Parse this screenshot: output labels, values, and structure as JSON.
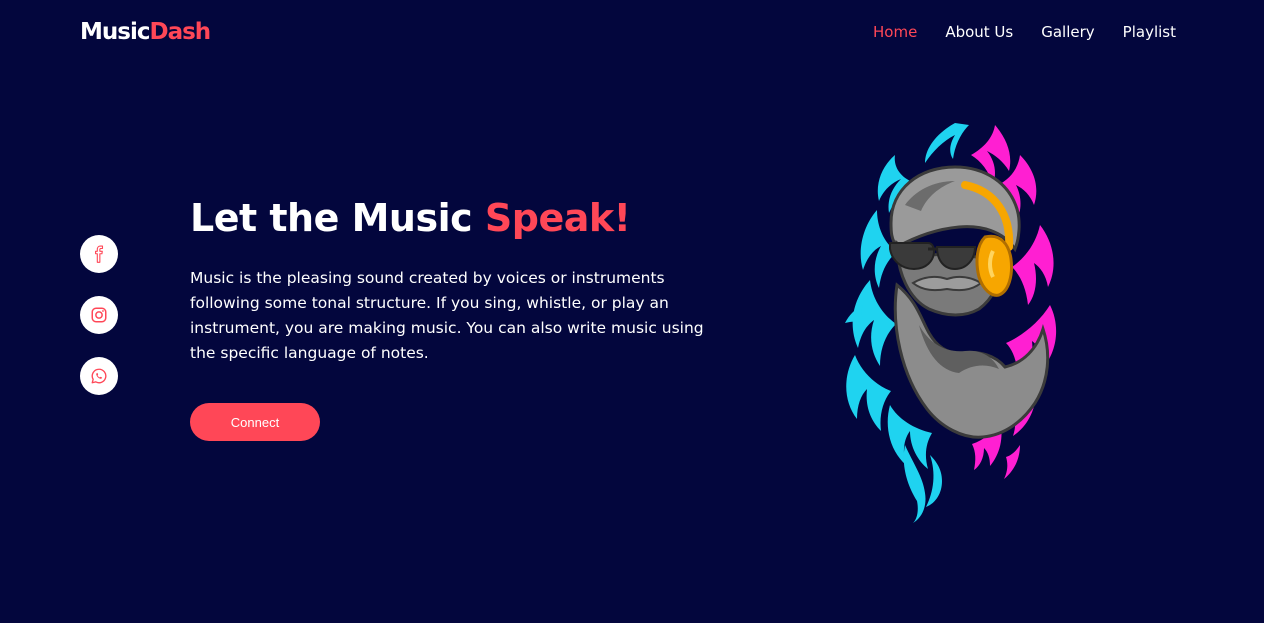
{
  "header": {
    "logo": {
      "part1": "Music",
      "part2": "Dash"
    },
    "nav": [
      {
        "label": "Home",
        "active": true
      },
      {
        "label": "About Us",
        "active": false
      },
      {
        "label": "Gallery",
        "active": false
      },
      {
        "label": "Playlist",
        "active": false
      }
    ]
  },
  "social": [
    {
      "icon": "facebook-icon"
    },
    {
      "icon": "instagram-icon"
    },
    {
      "icon": "whatsapp-icon"
    }
  ],
  "hero": {
    "title_plain": "Let the Music ",
    "title_accent": "Speak!",
    "text": "Music is the pleasing sound created by voices or instruments following some tonal structure. If you sing, whistle, or play an instrument, you are making music. You can also write music using the specific language of notes.",
    "button_label": "Connect"
  },
  "colors": {
    "background": "#03063d",
    "accent": "#ff4757",
    "text": "#ffffff",
    "flame_cyan": "#1fd3f0",
    "flame_magenta": "#ff1fd2",
    "headphones": "#f7a600"
  }
}
